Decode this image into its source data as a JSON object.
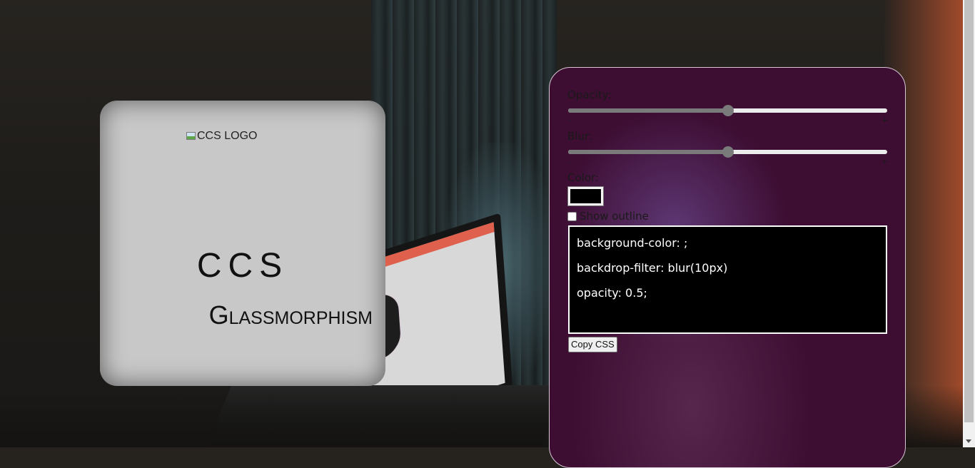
{
  "card": {
    "logo_alt": "CCS LOGO",
    "title": "CCS",
    "subtitle": "Glassmorphism"
  },
  "controls": {
    "opacity": {
      "label": "Opacity:",
      "value": 0.5,
      "min_label": "-",
      "max_label": "+"
    },
    "blur": {
      "label": "Blur:",
      "value": 0.5,
      "min_label": "-",
      "max_label": "+"
    },
    "color": {
      "label": "Color:",
      "value": "#000000"
    },
    "outline": {
      "label": "Show outline",
      "checked": false
    },
    "css_output": [
      "background-color: ;",
      "backdrop-filter: blur(10px)",
      "opacity: 0.5;"
    ],
    "copy_button_label": "Copy CSS"
  },
  "colors": {
    "panel_bg": "#3d0d32",
    "card_bg": "#c8c8c8",
    "code_bg": "#000000"
  }
}
